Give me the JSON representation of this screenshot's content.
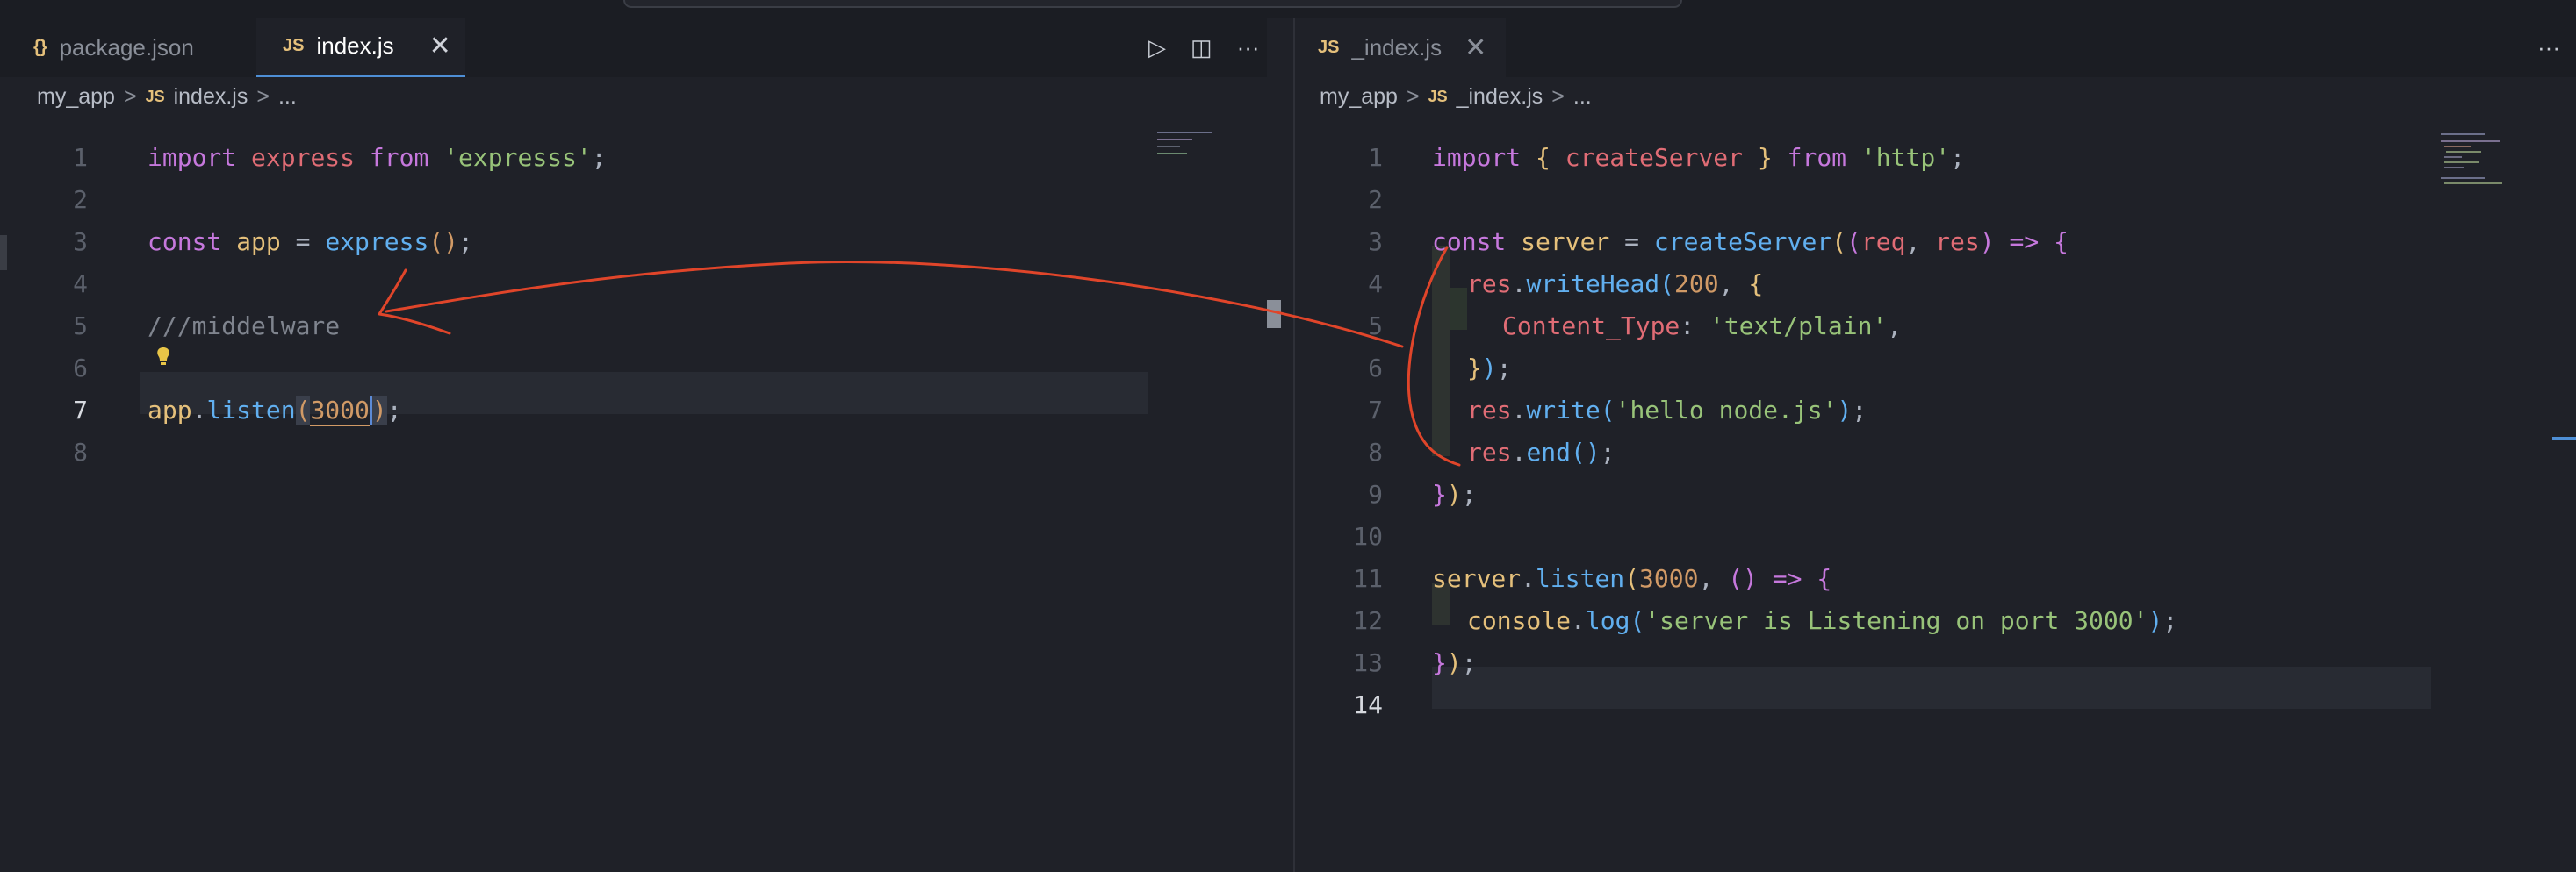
{
  "left_pane": {
    "tabs": [
      {
        "icon": "{}",
        "label": "package.json",
        "active": false
      },
      {
        "icon": "JS",
        "label": "index.js",
        "active": true,
        "close": "✕"
      }
    ],
    "actions": {
      "run": "▷",
      "split": "◫",
      "more": "···"
    },
    "breadcrumb": {
      "folder": "my_app",
      "sep": ">",
      "icon": "JS",
      "file": "index.js",
      "ellipsis": "..."
    },
    "lines": [
      {
        "num": "1"
      },
      {
        "num": "2"
      },
      {
        "num": "3"
      },
      {
        "num": "4"
      },
      {
        "num": "5"
      },
      {
        "num": "6"
      },
      {
        "num": "7"
      },
      {
        "num": "8"
      }
    ],
    "tokens": {
      "l1": [
        "import",
        " express ",
        "from",
        " ",
        "'expresss'",
        ";"
      ],
      "l3": [
        "const",
        " app ",
        "= ",
        "express",
        "()",
        ";"
      ],
      "l5": "///middelware",
      "l7": [
        "app",
        ".",
        "listen",
        "(",
        "3000",
        ")",
        ";"
      ]
    },
    "current_line": "7"
  },
  "right_pane": {
    "tabs": [
      {
        "icon": "JS",
        "label": "_index.js",
        "active": false,
        "close": "✕"
      }
    ],
    "actions": {
      "more": "···"
    },
    "breadcrumb": {
      "folder": "my_app",
      "sep": ">",
      "icon": "JS",
      "file": "_index.js",
      "ellipsis": "..."
    },
    "lines": [
      {
        "num": "1"
      },
      {
        "num": "2"
      },
      {
        "num": "3"
      },
      {
        "num": "4"
      },
      {
        "num": "5"
      },
      {
        "num": "6"
      },
      {
        "num": "7"
      },
      {
        "num": "8"
      },
      {
        "num": "9"
      },
      {
        "num": "10"
      },
      {
        "num": "11"
      },
      {
        "num": "12"
      },
      {
        "num": "13"
      },
      {
        "num": "14"
      }
    ],
    "tokens": {
      "l1": [
        "import",
        " ",
        "{",
        " createServer ",
        "}",
        " ",
        "from",
        " ",
        "'http'",
        ";"
      ],
      "l3": [
        "const",
        " ",
        "server",
        " = ",
        "createServer",
        "(",
        "(",
        "req",
        ", ",
        "res",
        ")",
        " => ",
        "{"
      ],
      "l4": [
        "res",
        ".",
        "writeHead",
        "(",
        "200",
        ", ",
        "{"
      ],
      "l5": [
        "Content_Type",
        ": ",
        "'text/plain'",
        ","
      ],
      "l6": [
        "}",
        ")",
        ";"
      ],
      "l7": [
        "res",
        ".",
        "write",
        "(",
        "'hello node.js'",
        ")",
        ";"
      ],
      "l8": [
        "res",
        ".",
        "end",
        "()",
        ";"
      ],
      "l9": [
        "}",
        ")",
        ";"
      ],
      "l11": [
        "server",
        ".",
        "listen",
        "(",
        "3000",
        ", ",
        "()",
        " => ",
        "{"
      ],
      "l12": [
        "console",
        ".",
        "log",
        "(",
        "'server is Listening on port 3000'",
        ")",
        ";"
      ],
      "l13": [
        "}",
        ")",
        ";"
      ]
    },
    "current_line": "14"
  },
  "colors": {
    "keyword": "#c678dd",
    "variable": "#e06c75",
    "string": "#98c379",
    "function": "#61afef",
    "number": "#d19a66",
    "comment": "#7f848e",
    "annotation": "#e0452a",
    "active_tab_border": "#4e8fd6"
  }
}
